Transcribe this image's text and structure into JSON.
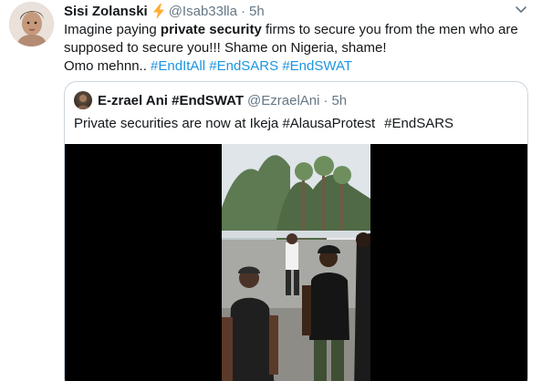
{
  "tweet": {
    "display_name": "Sisi Zolanski",
    "handle": "@Isab33lla",
    "separator": "·",
    "time": "5h",
    "name_icon": "lightning-bolt-icon",
    "menu_icon": "chevron-down-icon",
    "text": {
      "l1_before": "Imagine paying ",
      "l1_bold": "private security",
      "l1_after": " firms to secure you from the men who are",
      "l2": "supposed to secure you!!! Shame on Nigeria, shame!",
      "l3_prefix": "Omo mehnn.. ",
      "hashtags": [
        "#EndItAll",
        "#EndSARS",
        "#EndSWAT"
      ]
    }
  },
  "quoted": {
    "display_name": "E-zrael Ani #EndSWAT",
    "handle": "@EzraelAni",
    "separator": "·",
    "time": "5h",
    "text_prefix": "Private securities are now at Ikeja ",
    "hashtags": [
      "#AlausaProtest",
      "#EndSARS"
    ],
    "media": "video-thumbnail"
  },
  "colors": {
    "text": "#14171a",
    "secondary": "#657786",
    "link": "#1b95e0",
    "border": "#ccd6dd",
    "bolt": "#ffac33",
    "video_bg": "#000000"
  }
}
